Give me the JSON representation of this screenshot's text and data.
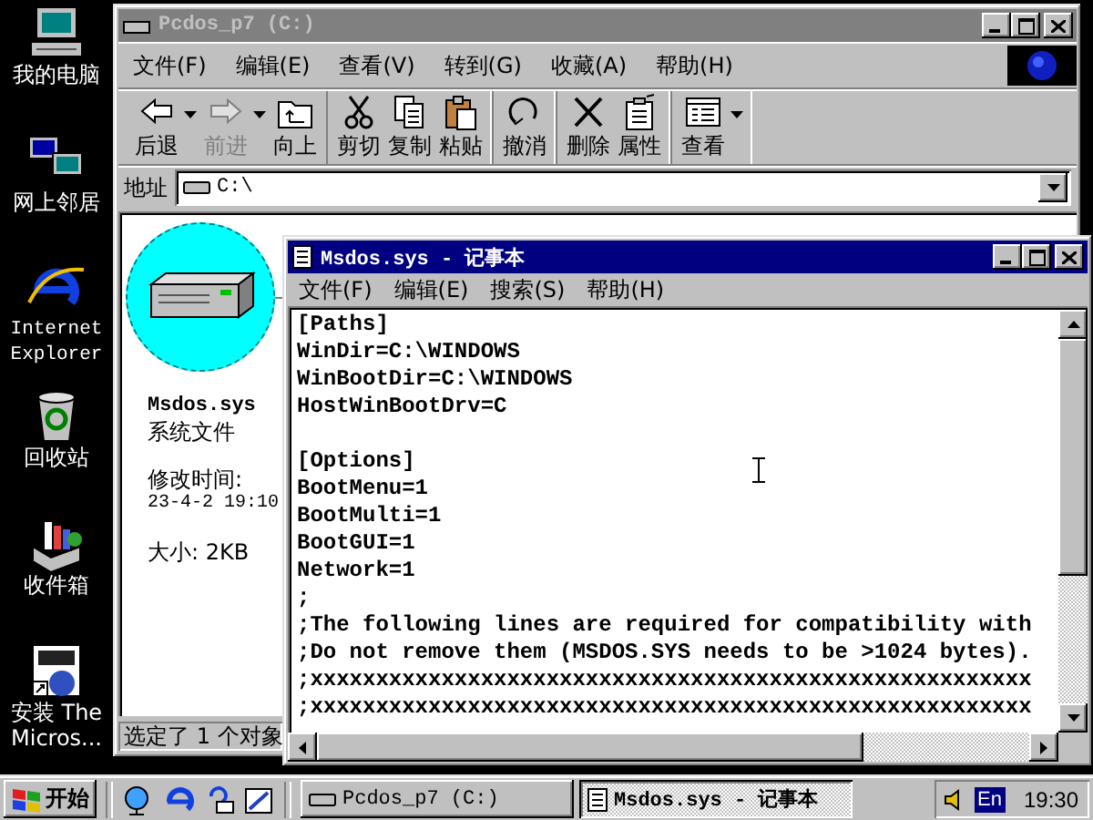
{
  "desktop_icons": [
    {
      "label": "我的电脑",
      "kind": "computer"
    },
    {
      "label": "网上邻居",
      "kind": "network"
    },
    {
      "label": "Internet Explorer",
      "kind": "browser"
    },
    {
      "label": "回收站",
      "kind": "recycle"
    },
    {
      "label": "收件箱",
      "kind": "inbox"
    },
    {
      "label": "安装 The Micros...",
      "kind": "setup"
    }
  ],
  "explorer": {
    "title": "Pcdos_p7 (C:)",
    "active": false,
    "menu": [
      "文件(F)",
      "编辑(E)",
      "查看(V)",
      "转到(G)",
      "收藏(A)",
      "帮助(H)"
    ],
    "toolbar": [
      [
        {
          "label": "后退",
          "kind": "back",
          "disabled": false,
          "dropdown": true
        },
        {
          "label": "前进",
          "kind": "forward",
          "disabled": true,
          "dropdown": true
        },
        {
          "label": "向上",
          "kind": "up",
          "disabled": false,
          "dropdown": false
        }
      ],
      [
        {
          "label": "剪切",
          "kind": "cut",
          "disabled": false,
          "dropdown": false
        },
        {
          "label": "复制",
          "kind": "copy",
          "disabled": false,
          "dropdown": false
        },
        {
          "label": "粘贴",
          "kind": "paste",
          "disabled": false,
          "dropdown": false
        }
      ],
      [
        {
          "label": "撤消",
          "kind": "undo",
          "disabled": false,
          "dropdown": false
        }
      ],
      [
        {
          "label": "删除",
          "kind": "delete",
          "disabled": false,
          "dropdown": false
        },
        {
          "label": "属性",
          "kind": "properties",
          "disabled": false,
          "dropdown": false
        }
      ],
      [
        {
          "label": "查看",
          "kind": "views",
          "disabled": false,
          "dropdown": true
        }
      ]
    ],
    "address": {
      "label": "地址",
      "value": "C:\\"
    },
    "details": {
      "file_name": "Msdos.sys",
      "file_type": "系统文件",
      "modified_label": "修改时间:",
      "modified": "23-4-2 19:10",
      "size": "大小: 2KB"
    },
    "status_bar": "选定了 1 个对象"
  },
  "notepad": {
    "title": "Msdos.sys - 记事本",
    "active": true,
    "menu": [
      "文件(F)",
      "编辑(E)",
      "搜索(S)",
      "帮助(H)"
    ],
    "blocks": [
      [
        "[Paths]",
        "WinDir=C:\\WINDOWS",
        "WinBootDir=C:\\WINDOWS",
        "HostWinBootDrv=C"
      ],
      [
        "[Options]",
        "BootMenu=1",
        "BootMulti=1",
        "BootGUI=1",
        "Network=1",
        ";",
        ";The following lines are required for compatibility with",
        ";Do not remove them (MSDOS.SYS needs to be >1024 bytes).",
        ";xxxxxxxxxxxxxxxxxxxxxxxxxxxxxxxxxxxxxxxxxxxxxxxxxxxxxxx",
        ";xxxxxxxxxxxxxxxxxxxxxxxxxxxxxxxxxxxxxxxxxxxxxxxxxxxxxxx"
      ]
    ]
  },
  "taskbar": {
    "start": "开始",
    "tasks": [
      {
        "label": "Pcdos_p7 (C:)",
        "kind": "folder",
        "selected": false
      },
      {
        "label": "Msdos.sys - 记事本",
        "kind": "notepad",
        "selected": true
      }
    ],
    "language": "En",
    "clock": "19:30"
  }
}
